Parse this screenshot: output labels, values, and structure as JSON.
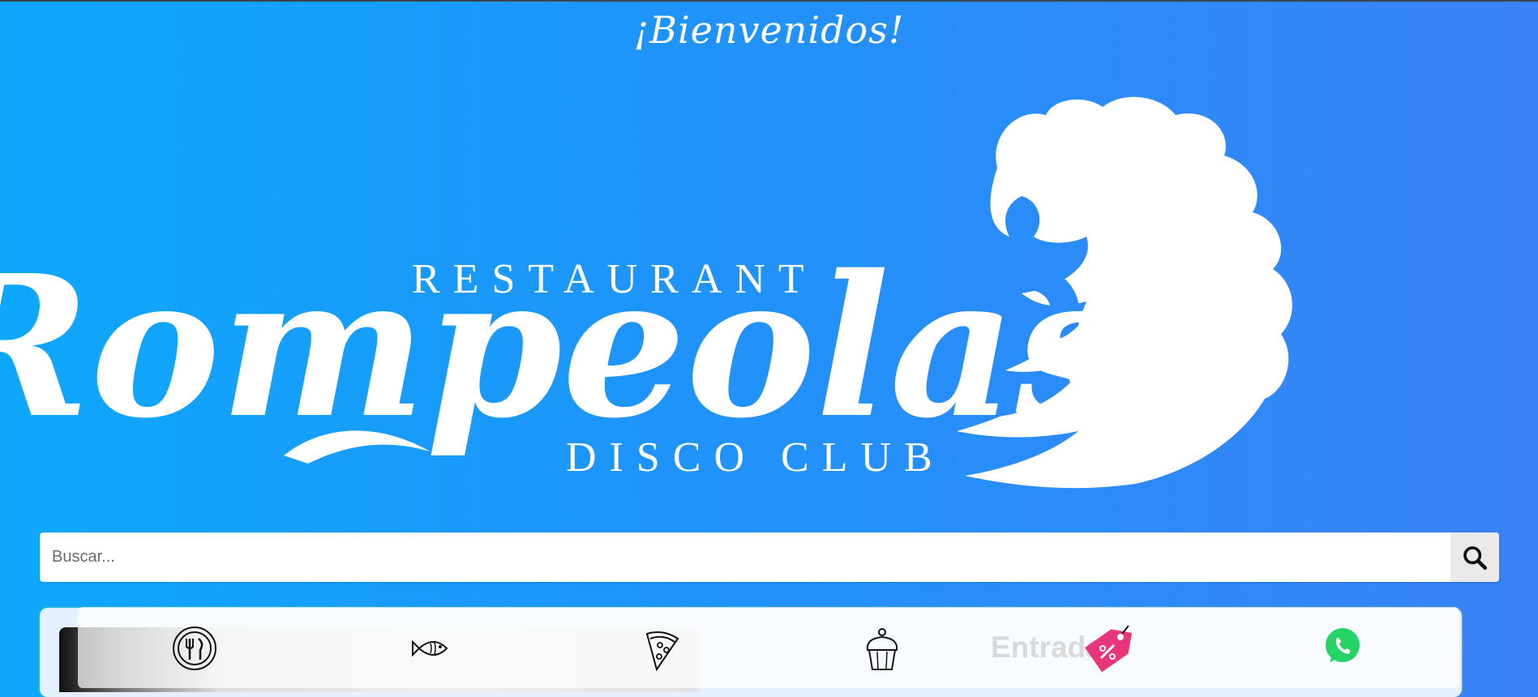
{
  "header": {
    "greeting": "¡Bienvenidos!"
  },
  "logo": {
    "line_top": "RESTAURANT",
    "wordmark": "Rompeolas",
    "line_bottom": "DISCO CLUB"
  },
  "search": {
    "placeholder": "Buscar...",
    "button_icon": "search-icon"
  },
  "categories": [
    {
      "icon": "plate-cutlery-icon"
    },
    {
      "icon": "fish-icon"
    },
    {
      "icon": "pizza-icon"
    },
    {
      "icon": "cupcake-icon"
    },
    {
      "label": "Entrada",
      "icon": "discount-tag-icon"
    },
    {
      "icon": "whatsapp-icon"
    }
  ],
  "colors": {
    "bg_start": "#0ea8fb",
    "bg_end": "#3a82f6",
    "tag": "#e8367b",
    "whatsapp": "#25d366"
  }
}
